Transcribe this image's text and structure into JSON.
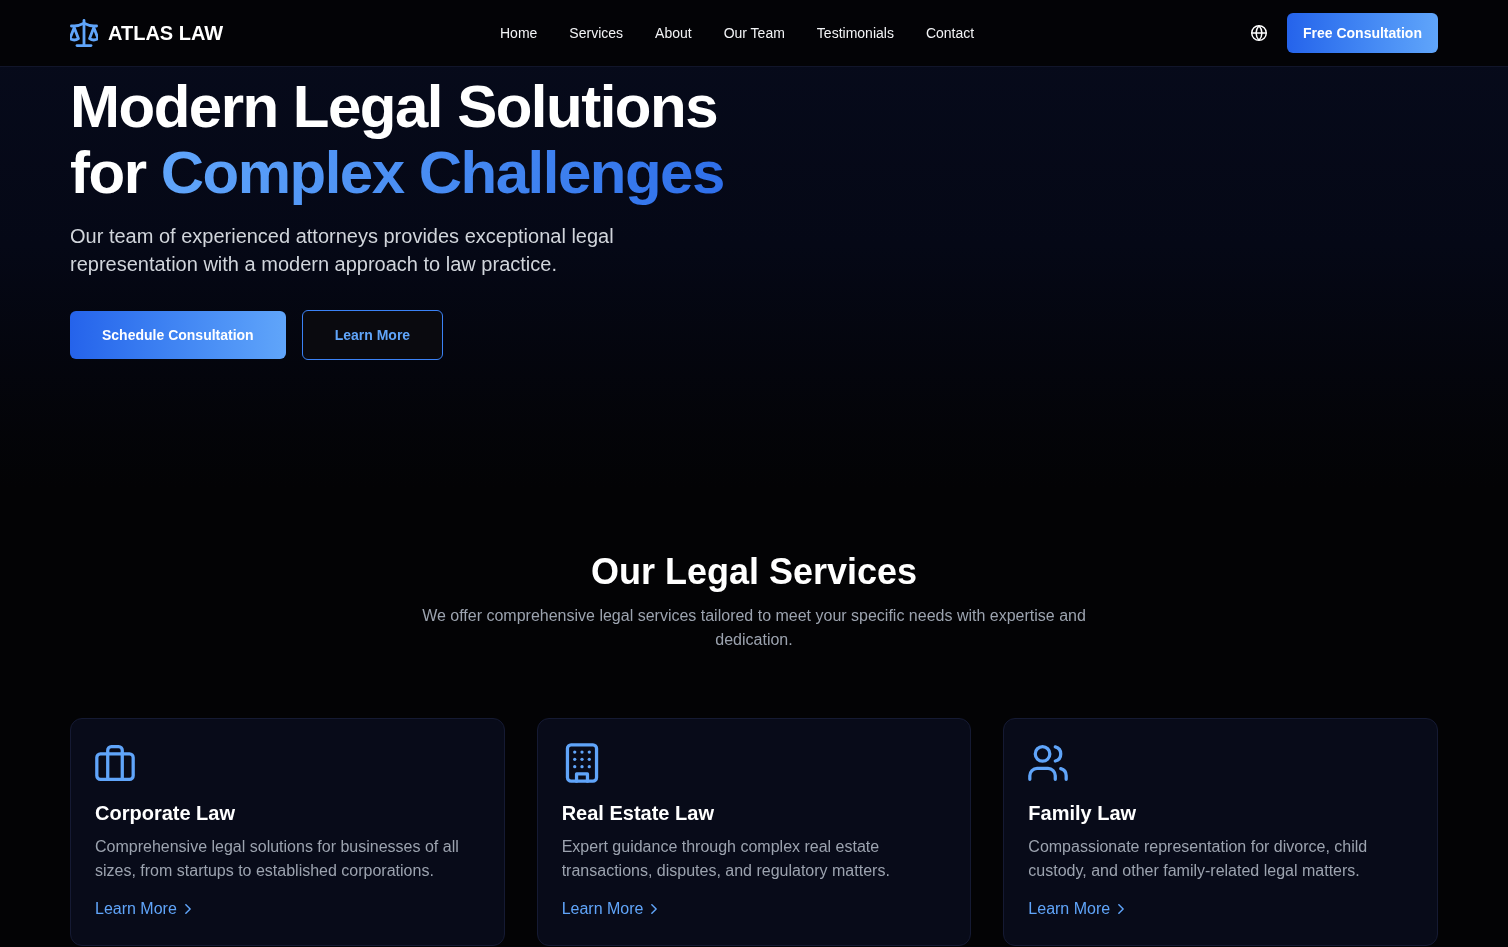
{
  "header": {
    "logo": "ATLAS LAW",
    "nav": [
      "Home",
      "Services",
      "About",
      "Our Team",
      "Testimonials",
      "Contact"
    ],
    "cta": "Free Consultation"
  },
  "hero": {
    "title": "Modern Legal Solutions for",
    "title_highlight": "Complex Challenges",
    "subtitle": "Our team of experienced attorneys provides exceptional legal representation with a modern approach to law practice.",
    "buttons": [
      {
        "label": "Schedule Consultation",
        "kind": "primary"
      },
      {
        "label": "Learn More",
        "kind": "outline"
      }
    ]
  },
  "services": {
    "title": "Our Legal Services",
    "subtitle": "We offer comprehensive legal services tailored to meet your specific needs with expertise and dedication.",
    "cards": [
      {
        "title": "Corporate Law",
        "description": "Comprehensive legal solutions for businesses of all sizes, from startups to established corporations.",
        "link": "Learn More"
      },
      {
        "title": "Real Estate Law",
        "description": "Expert guidance through complex real estate transactions, disputes, and regulatory matters.",
        "link": "Learn More"
      },
      {
        "title": "Family Law",
        "description": "Compassionate representation for divorce, child custody, and other family-related legal matters.",
        "link": "Learn More"
      }
    ]
  }
}
